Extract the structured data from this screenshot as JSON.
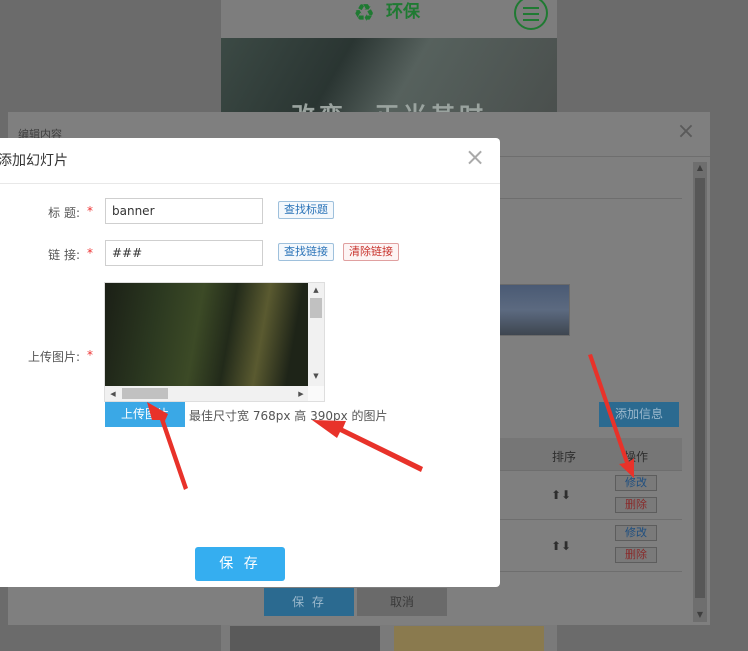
{
  "background_page": {
    "logo_icon": "♻",
    "logo_text": "环保",
    "banner_text": "改变，正当其时"
  },
  "outer_modal": {
    "title": "编辑内容",
    "close_icon": "×",
    "add_button": "添加信息",
    "table_header": {
      "sort": "排序",
      "operation": "操作"
    },
    "rows": [
      {
        "sort_icons": "⬆⬇",
        "edit": "修改",
        "delete": "删除"
      },
      {
        "sort_icons": "⬆⬇",
        "edit": "修改",
        "delete": "删除"
      }
    ],
    "save_button": "保 存",
    "cancel_button": "取消",
    "scroll_up": "▲",
    "scroll_down": "▼"
  },
  "dialog": {
    "title": "添加幻灯片",
    "close_icon": "×",
    "fields": {
      "title": {
        "label": "标 题:",
        "required_mark": "*",
        "value": "banner",
        "button": "查找标题"
      },
      "link": {
        "label": "链 接:",
        "required_mark": "*",
        "value": "###",
        "button": "查找链接",
        "clear_button": "清除链接"
      },
      "image": {
        "label": "上传图片:",
        "required_mark": "*"
      }
    },
    "image_scroll": {
      "up": "▲",
      "down": "▼",
      "left": "◀",
      "right": "▶"
    },
    "upload_button": "上传图片",
    "upload_hint": "最佳尺寸宽 768px 高 390px 的图片",
    "save_button": "保 存"
  },
  "colors": {
    "accent_blue": "#35aef0",
    "annotation_red": "#e8322a",
    "required_red": "#ee3333"
  }
}
